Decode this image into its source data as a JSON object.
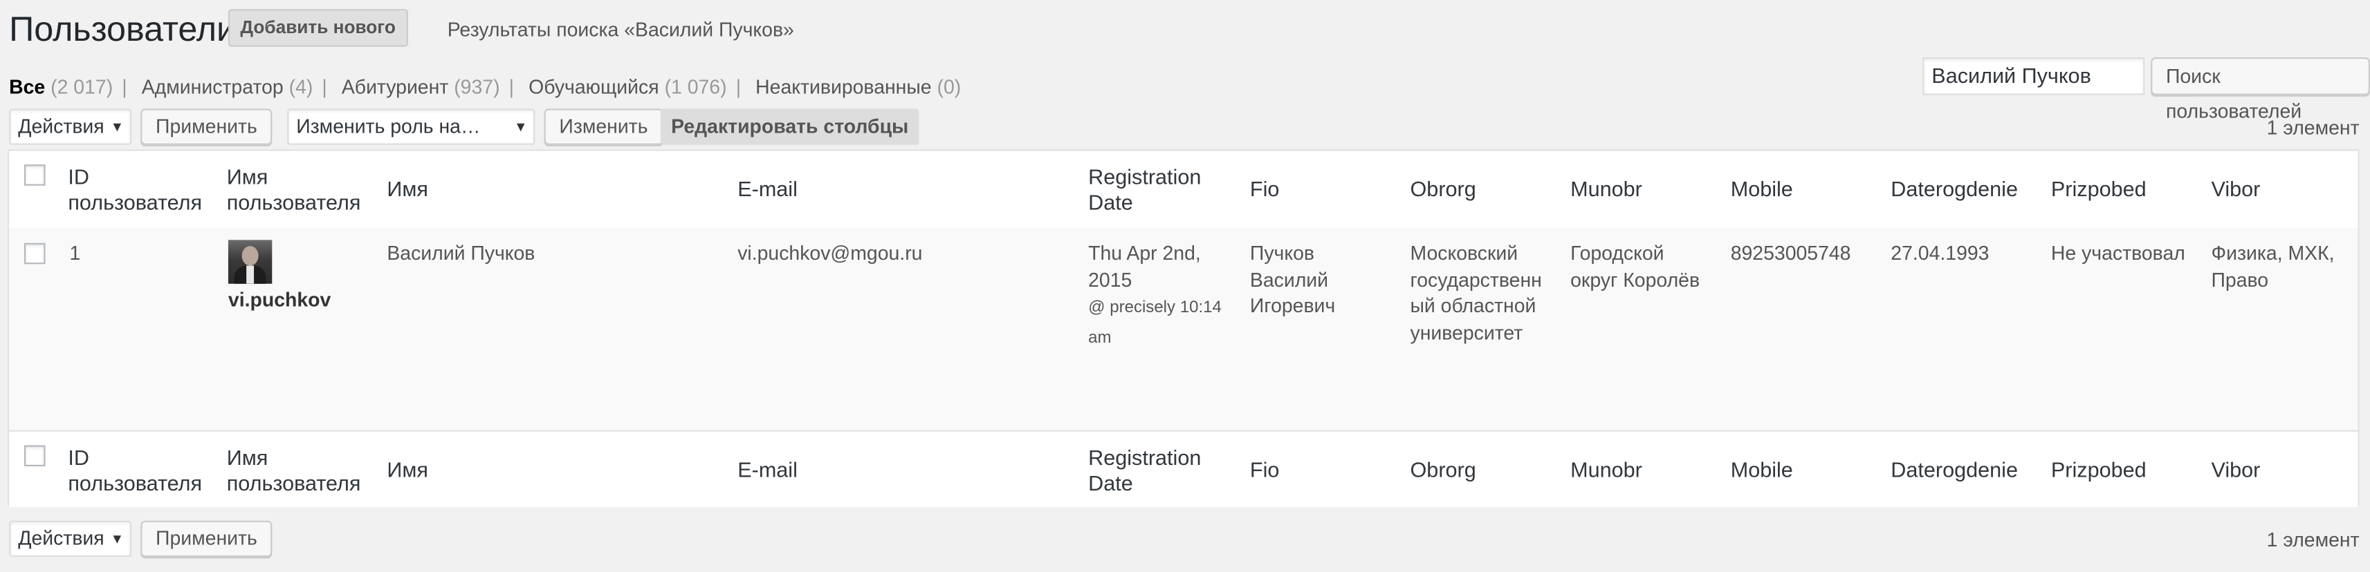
{
  "header": {
    "title": "Пользователи",
    "add_new": "Добавить нового",
    "search_subtitle": "Результаты поиска «Василий Пучков»"
  },
  "views": [
    {
      "label": "Все",
      "count": "(2 017)",
      "current": true
    },
    {
      "label": "Администратор",
      "count": "(4)"
    },
    {
      "label": "Абитуриент",
      "count": "(937)"
    },
    {
      "label": "Обучающийся",
      "count": "(1 076)"
    },
    {
      "label": "Неактивированные",
      "count": "(0)"
    }
  ],
  "search": {
    "value": "Василий Пучков",
    "button": "Поиск пользователей"
  },
  "toolbar_top": {
    "bulk_action": "Действия",
    "apply": "Применить",
    "change_role": "Изменить роль на…",
    "change": "Изменить",
    "edit_columns": "Редактировать столбцы",
    "count": "1 элемент"
  },
  "toolbar_bottom": {
    "bulk_action": "Действия",
    "apply": "Применить",
    "count": "1 элемент"
  },
  "columns": {
    "id_1": "ID",
    "id_2": "пользователя",
    "username_1": "Имя",
    "username_2": "пользователя",
    "name": "Имя",
    "email": "E-mail",
    "regdate_1": "Registration",
    "regdate_2": "Date",
    "fio": "Fio",
    "obrorg": "Obrorg",
    "munobr": "Munobr",
    "mobile": "Mobile",
    "daterogdenie": "Daterogdenie",
    "prizpobed": "Prizpobed",
    "vibor": "Vibor"
  },
  "rows": [
    {
      "id": "1",
      "login": "vi.puchkov",
      "name": "Василий Пучков",
      "email": "vi.puchkov@mgou.ru",
      "regdate_1": "Thu Apr 2nd,",
      "regdate_2": "2015",
      "regtime_1": "@ precisely 10:14",
      "regtime_2": "am",
      "fio_1": "Пучков",
      "fio_2": "Василий",
      "fio_3": "Игоревич",
      "obrorg_1": "Московский",
      "obrorg_2": "государственн",
      "obrorg_3": "ый областной",
      "obrorg_4": "университет",
      "munobr_1": "Городской",
      "munobr_2": "округ Королёв",
      "mobile": "89253005748",
      "daterogdenie": "27.04.1993",
      "prizpobed": "Не участвовал",
      "vibor_1": "Физика, МХК,",
      "vibor_2": "Право"
    }
  ]
}
